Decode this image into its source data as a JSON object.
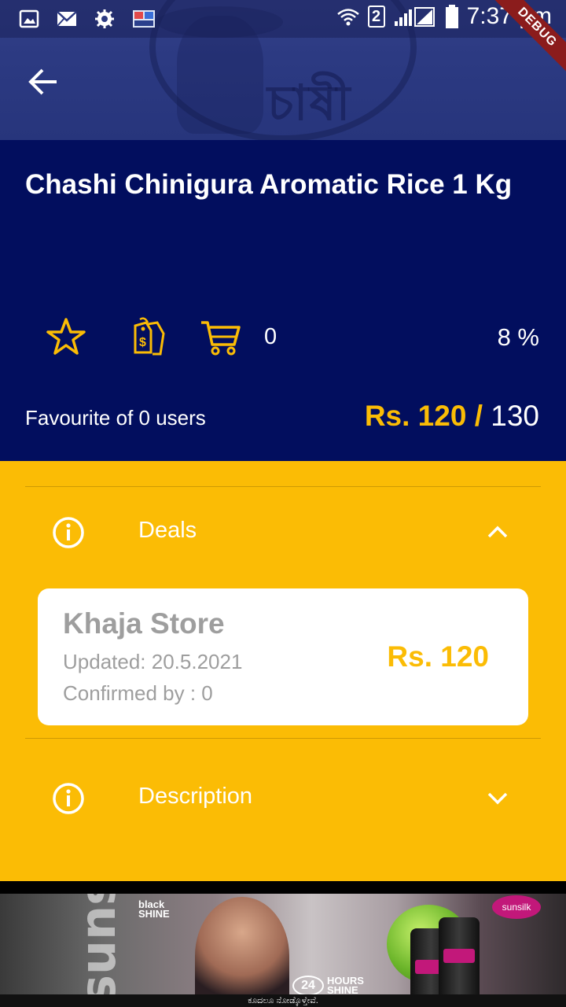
{
  "status_bar": {
    "time": "7:37 pm",
    "sim_number": "2",
    "icons": [
      "image-icon",
      "mail-icon",
      "settings-gear-icon",
      "app-icon",
      "wifi-icon",
      "sim-icon",
      "signal-icon",
      "battery-icon"
    ]
  },
  "debug_banner": "DEBUG",
  "hero": {
    "logo_text": "চাষী"
  },
  "product": {
    "title": "Chashi Chinigura Aromatic Rice 1 Kg",
    "cart_count": "0",
    "discount": "8 %",
    "favourite_text": "Favourite of 0 users",
    "sale_price": "Rs. 120",
    "price_separator": " / ",
    "original_price": "130"
  },
  "accordion": {
    "deals": {
      "label": "Deals",
      "expanded": true
    },
    "description": {
      "label": "Description",
      "expanded": false
    }
  },
  "deal": {
    "store": "Khaja Store",
    "updated": "Updated: 20.5.2021",
    "confirmed": "Confirmed by : 0",
    "price": "Rs. 120"
  },
  "ad": {
    "brand": "sunsilk",
    "sub_brand_line1": "black",
    "sub_brand_line2": "SHINE",
    "hours_num": "24",
    "hours_line1": "HOURS",
    "hours_line2": "SHINE",
    "footnote": "ಕೂದಲೂ ನೋಡ್ಕೊಳ್ತೇವೆ."
  },
  "colors": {
    "accent_yellow": "#fbbc05",
    "navy": "#020e5e",
    "white": "#ffffff",
    "grey_text": "#9e9e9e"
  }
}
